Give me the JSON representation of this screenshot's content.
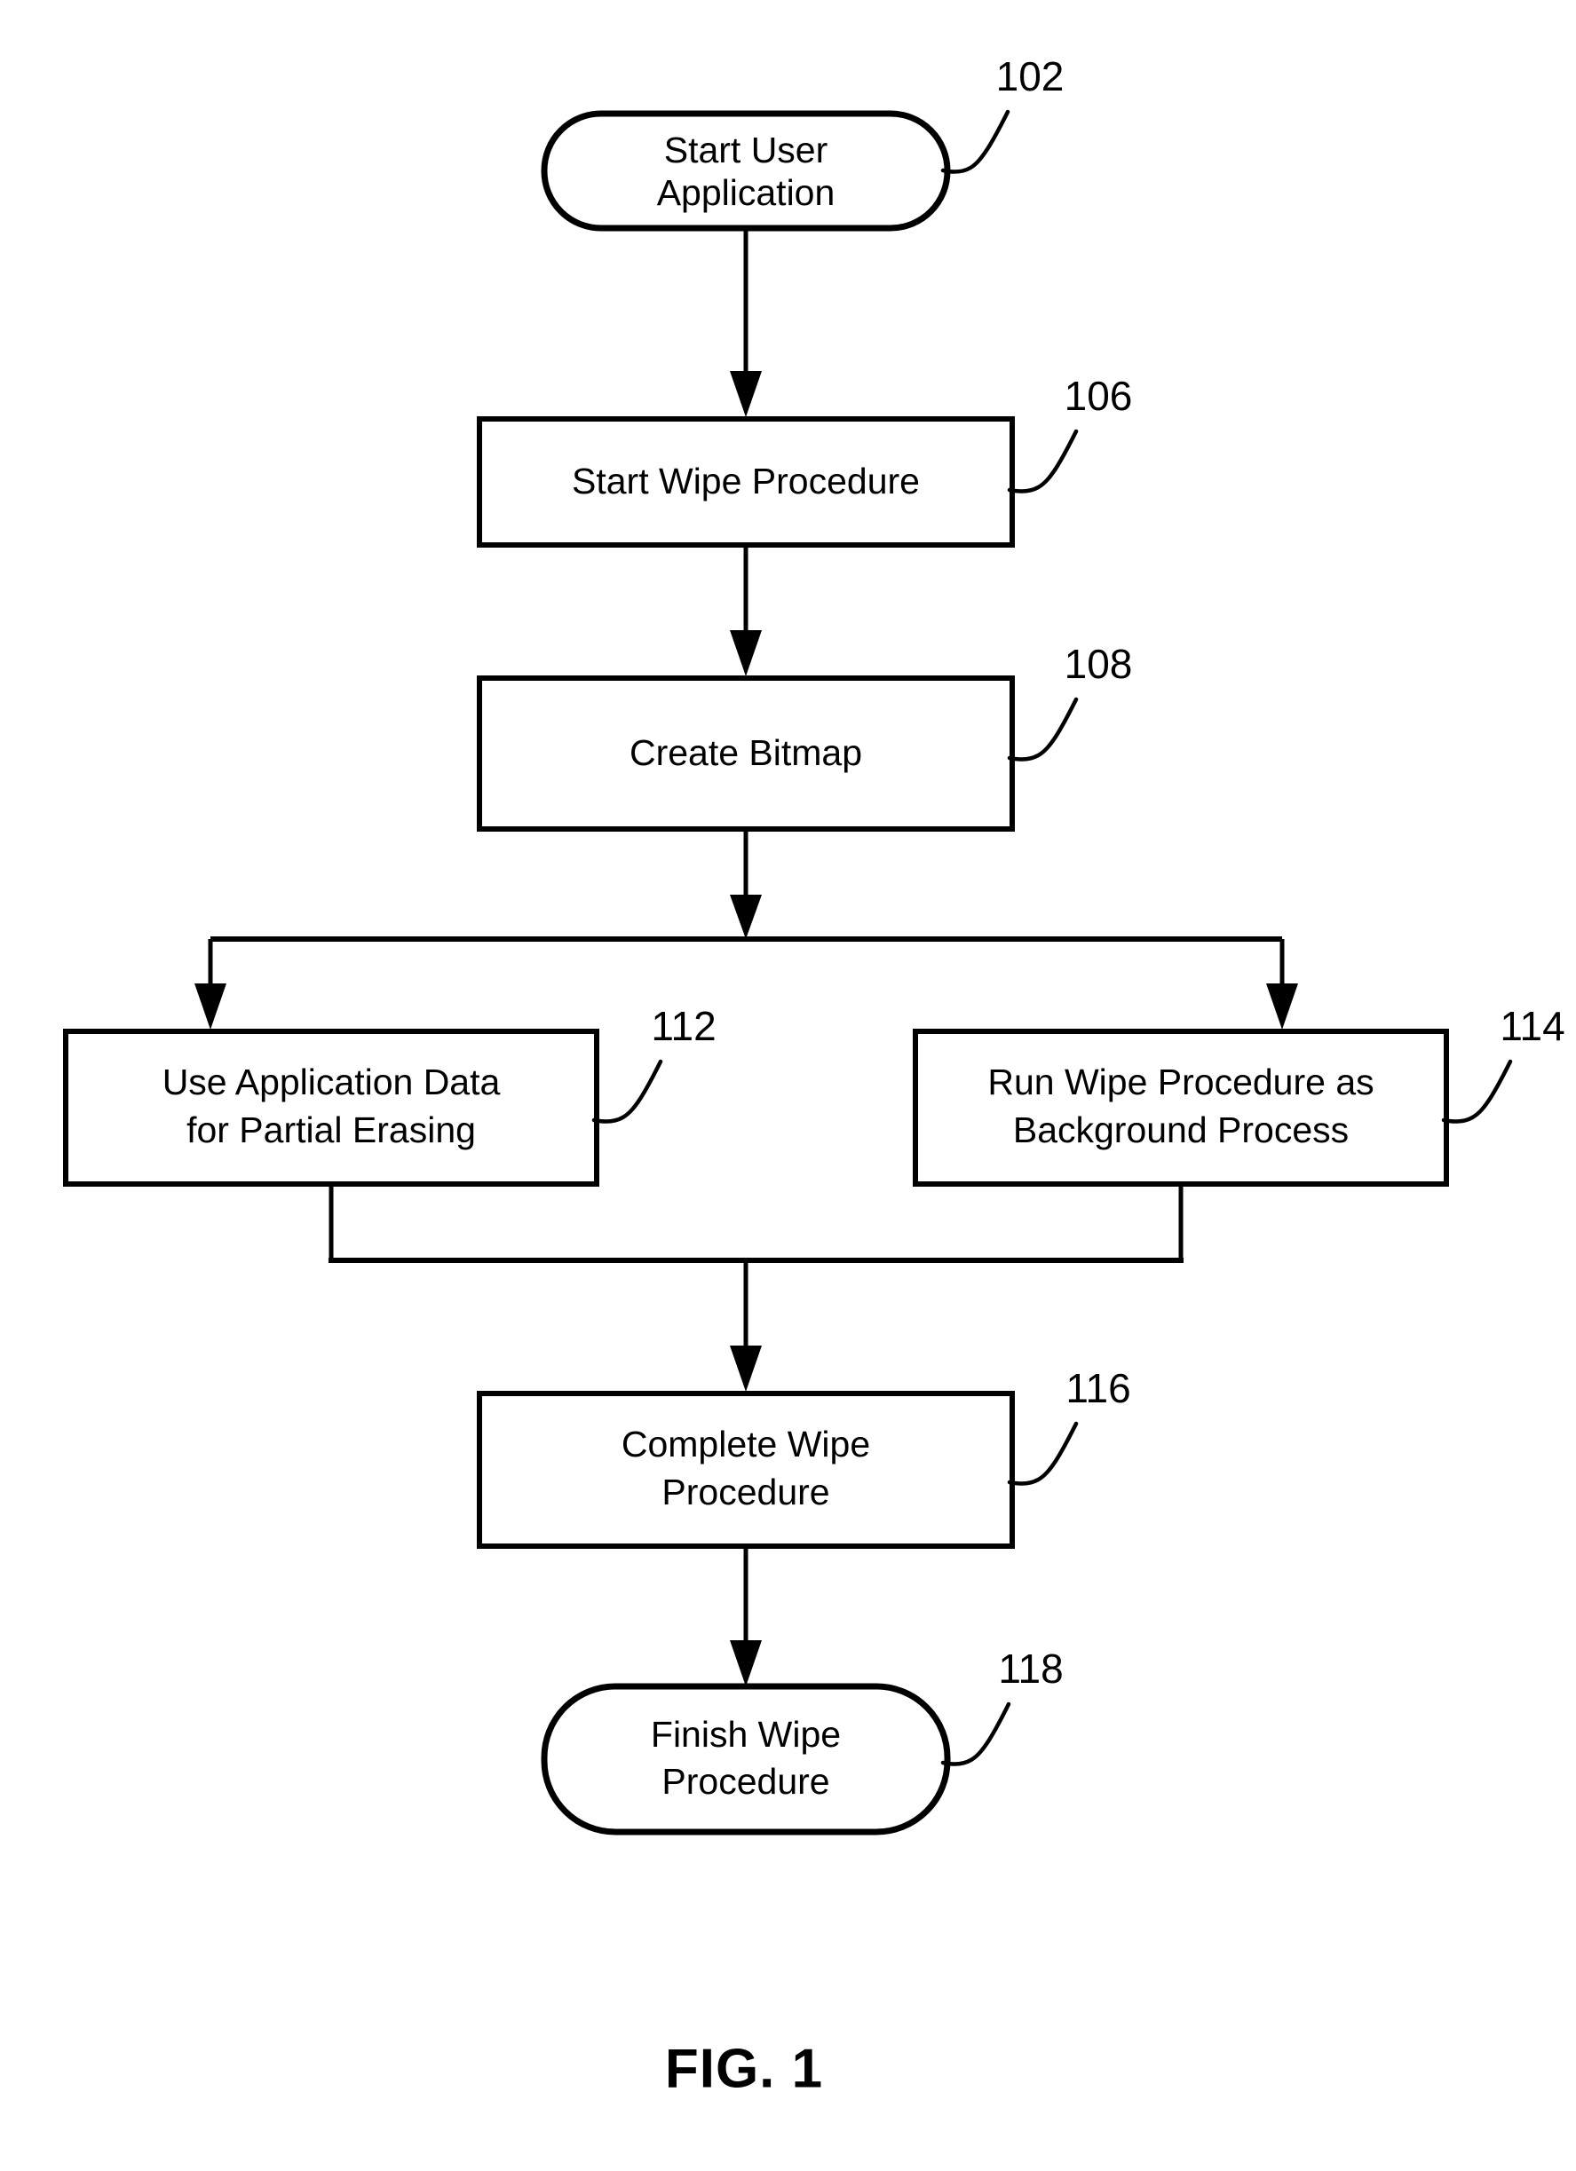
{
  "figure": {
    "caption": "FIG. 1"
  },
  "diagram": {
    "type": "flowchart",
    "orientation": "top-to-bottom",
    "nodes": [
      {
        "id": "n102",
        "ref": "102",
        "shape": "terminal",
        "lines": [
          "Start User",
          "Application"
        ],
        "line1": "Start User",
        "line2": "Application"
      },
      {
        "id": "n106",
        "ref": "106",
        "shape": "process",
        "lines": [
          "Start Wipe Procedure"
        ],
        "line1": "Start Wipe Procedure",
        "line2": ""
      },
      {
        "id": "n108",
        "ref": "108",
        "shape": "process",
        "lines": [
          "Create Bitmap"
        ],
        "line1": "Create Bitmap",
        "line2": ""
      },
      {
        "id": "n112",
        "ref": "112",
        "shape": "process",
        "lines": [
          "Use Application Data",
          "for Partial Erasing"
        ],
        "line1": "Use Application Data",
        "line2": "for Partial Erasing"
      },
      {
        "id": "n114",
        "ref": "114",
        "shape": "process",
        "lines": [
          "Run Wipe Procedure as",
          "Background Process"
        ],
        "line1": "Run Wipe Procedure as",
        "line2": "Background Process"
      },
      {
        "id": "n116",
        "ref": "116",
        "shape": "process",
        "lines": [
          "Complete Wipe",
          "Procedure"
        ],
        "line1": "Complete Wipe",
        "line2": "Procedure"
      },
      {
        "id": "n118",
        "ref": "118",
        "shape": "terminal",
        "lines": [
          "Finish Wipe",
          "Procedure"
        ],
        "line1": "Finish Wipe",
        "line2": "Procedure"
      }
    ],
    "edges": [
      {
        "from": "n102",
        "to": "n106",
        "kind": "arrow"
      },
      {
        "from": "n106",
        "to": "n108",
        "kind": "arrow"
      },
      {
        "from": "n108",
        "to": "fork",
        "kind": "arrow"
      },
      {
        "from": "fork",
        "to": "n112",
        "kind": "arrow"
      },
      {
        "from": "fork",
        "to": "n114",
        "kind": "arrow"
      },
      {
        "from": "n112",
        "to": "join",
        "kind": "line"
      },
      {
        "from": "n114",
        "to": "join",
        "kind": "line"
      },
      {
        "from": "join",
        "to": "n116",
        "kind": "arrow"
      },
      {
        "from": "n116",
        "to": "n118",
        "kind": "arrow"
      }
    ],
    "colors": {
      "stroke": "#000000",
      "fill": "#ffffff",
      "background": "#ffffff"
    }
  }
}
